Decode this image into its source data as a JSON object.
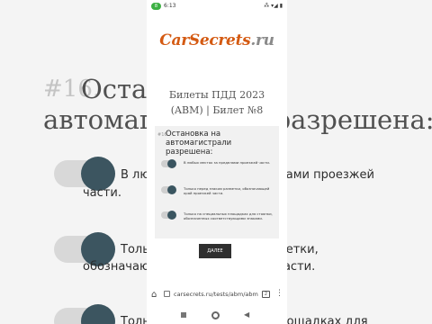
{
  "background": {
    "question_number": "#16.",
    "title_line1": "Остановка на",
    "title_line2": "автомагистрали разрешена:",
    "option1_line1": "В любых местах за пределами проезжей",
    "option1_line2": "части.",
    "option2_line1": "Только перед знаком разметки,",
    "option2_line2": "обозначающей край проезжей части.",
    "option3_line1": "Только на специальных площадках для"
  },
  "status_bar": {
    "indicator": "8",
    "time": "6:13",
    "right_icons": "⁂ ▾◢ ▮"
  },
  "logo": {
    "main": "CarSecrets",
    "suffix": ".ru"
  },
  "page_heading": "Билеты ПДД 2023 (ABM) | Билет №8",
  "question": {
    "number": "#16.",
    "title": "Остановка на автомагистрали разрешена:",
    "options": [
      "В любых местах за пределами проезжей части.",
      "Только перед знаком разметки, обозначающей край проезжей части.",
      "Только на специальных площадках для стоянки, обозначенных соответствующими знаками."
    ],
    "next_label": "ДАЛЕЕ"
  },
  "browser": {
    "url": "carsecrets.ru/tests/abm/abm",
    "tabs_count": "2"
  }
}
